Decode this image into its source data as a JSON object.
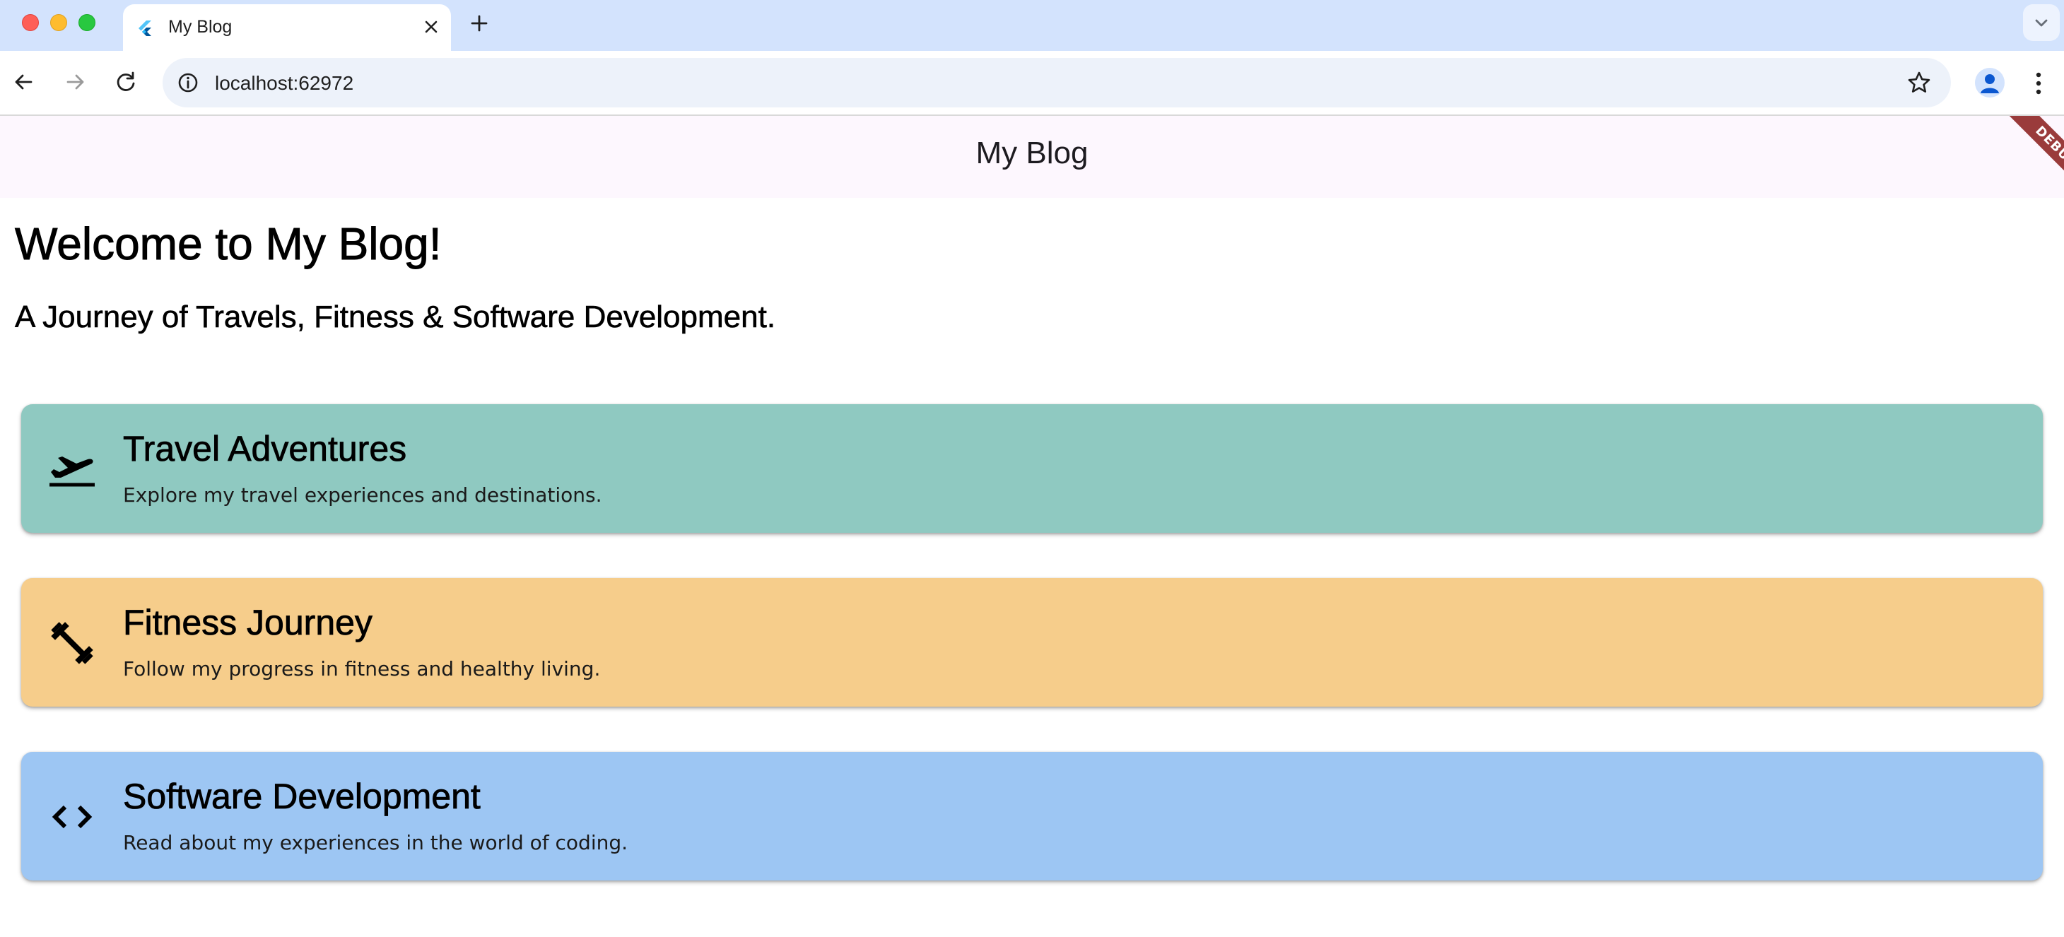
{
  "browser": {
    "tab_title": "My Blog",
    "url": "localhost:62972",
    "colors": {
      "tabstrip": "#d3e3fd",
      "omnibox": "#edf2fa"
    }
  },
  "app": {
    "appbar_title": "My Blog",
    "debug_banner": "DEBUG",
    "welcome": "Welcome to My Blog!",
    "subtitle": "A Journey of Travels, Fitness & Software Development.",
    "cards": [
      {
        "title": "Travel Adventures",
        "description": "Explore my travel experiences and destinations.",
        "icon": "flight-takeoff-icon",
        "color": "#8fc9c1"
      },
      {
        "title": "Fitness Journey",
        "description": "Follow my progress in fitness and healthy living.",
        "icon": "fitness-center-icon",
        "color": "#f6cd8b"
      },
      {
        "title": "Software Development",
        "description": "Read about my experiences in the world of coding.",
        "icon": "code-icon",
        "color": "#9dc6f3"
      }
    ]
  }
}
